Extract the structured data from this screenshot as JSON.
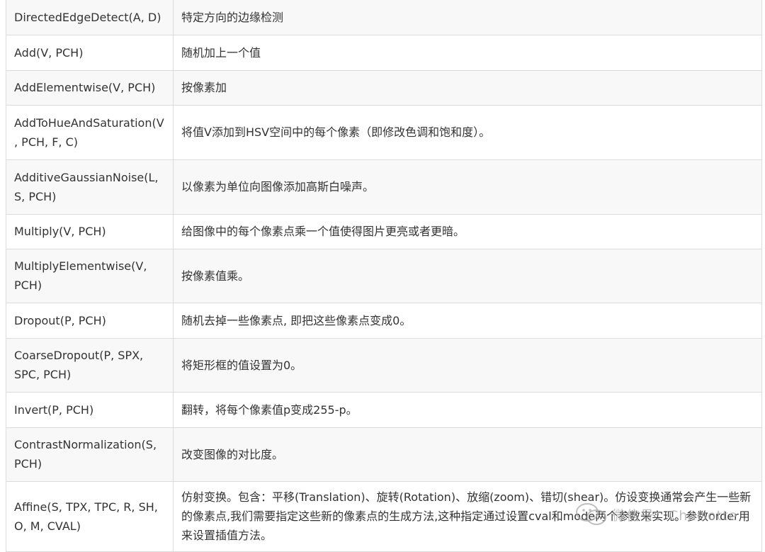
{
  "rows": [
    {
      "op": "DirectedEdgeDetect(A, D)",
      "desc": "特定方向的边缘检测"
    },
    {
      "op": "Add(V, PCH)",
      "desc": "随机加上一个值"
    },
    {
      "op": "AddElementwise(V, PCH)",
      "desc": "按像素加"
    },
    {
      "op": "AddToHueAndSaturation(V, PCH, F, C)",
      "desc": "将值V添加到HSV空间中的每个像素（即修改色调和饱和度）。"
    },
    {
      "op": "AdditiveGaussianNoise(L, S, PCH)",
      "desc": "以像素为单位向图像添加高斯白噪声。"
    },
    {
      "op": "Multiply(V, PCH)",
      "desc": "给图像中的每个像素点乘一个值使得图片更亮或者更暗。"
    },
    {
      "op": "MultiplyElementwise(V, PCH)",
      "desc": "按像素值乘。"
    },
    {
      "op": "Dropout(P, PCH)",
      "desc": "随机去掉一些像素点, 即把这些像素点变成0。"
    },
    {
      "op": "CoarseDropout(P, SPX, SPC, PCH)",
      "desc": "将矩形框的值设置为0。"
    },
    {
      "op": "Invert(P, PCH)",
      "desc": "翻转，将每个像素值p变成255-p。"
    },
    {
      "op": "ContrastNormalization(S, PCH)",
      "desc": "改变图像的对比度。"
    },
    {
      "op": "Affine(S, TPX, TPC, R, SH, O, M, CVAL)",
      "desc": "仿射变换。包含：平移(Translation)、旋转(Rotation)、放缩(zoom)、错切(shear)。仿设变换通常会产生一些新的像素点,我们需要指定这些新的像素点的生成方法,这种指定通过设置cval和mode两个参数来实现。参数order用来设置插值方法。"
    }
  ],
  "watermark": {
    "icon": "wechat-icon",
    "text": "微信号：Charlotte"
  },
  "colors": {
    "row_alt": "#f8f8f8",
    "row": "#ffffff",
    "border": "#dcdcdc",
    "text": "#333333"
  }
}
